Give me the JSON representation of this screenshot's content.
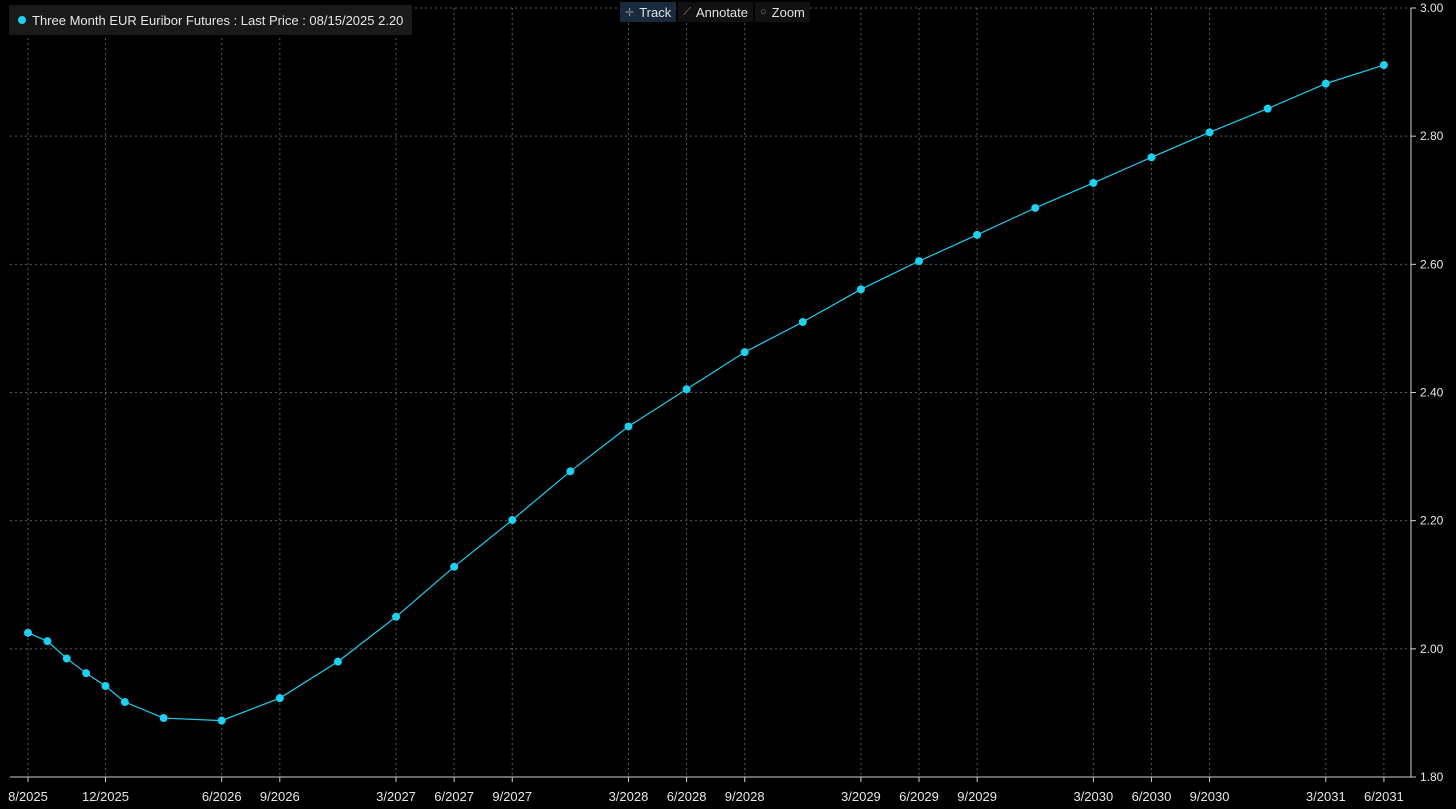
{
  "legend": {
    "label": "Three Month EUR Euribor Futures : Last Price : 08/15/2025 2.20"
  },
  "toolbar": {
    "track_label": "Track",
    "annotate_label": "Annotate",
    "zoom_label": "Zoom"
  },
  "colors": {
    "series": "#1fd0f0",
    "background": "#000000",
    "grid": "#5a5a5a"
  },
  "chart_data": {
    "type": "line",
    "title": "",
    "xlabel": "",
    "ylabel": "",
    "ylim": [
      1.8,
      3.0
    ],
    "yticks": [
      1.8,
      2.0,
      2.2,
      2.4,
      2.6,
      2.8,
      3.0
    ],
    "ytick_labels": [
      "1.80",
      "2.00",
      "2.20",
      "2.40",
      "2.60",
      "2.80",
      "3.00"
    ],
    "y_axis_side": "right",
    "grid": true,
    "legend_position": "top-left",
    "xticks": [
      "8/2025",
      "12/2025",
      "6/2026",
      "9/2026",
      "3/2027",
      "6/2027",
      "9/2027",
      "3/2028",
      "6/2028",
      "9/2028",
      "3/2029",
      "6/2029",
      "9/2029",
      "3/2030",
      "6/2030",
      "9/2030",
      "3/2031",
      "6/2031"
    ],
    "series": [
      {
        "name": "Three Month EUR Euribor Futures",
        "x": [
          "8/2025",
          "9/2025",
          "10/2025",
          "11/2025",
          "12/2025",
          "1/2026",
          "3/2026",
          "6/2026",
          "9/2026",
          "12/2026",
          "3/2027",
          "6/2027",
          "9/2027",
          "12/2027",
          "3/2028",
          "6/2028",
          "9/2028",
          "12/2028",
          "3/2029",
          "6/2029",
          "9/2029",
          "12/2029",
          "3/2030",
          "6/2030",
          "9/2030",
          "12/2030",
          "3/2031",
          "6/2031"
        ],
        "values": [
          2.025,
          2.012,
          1.985,
          1.962,
          1.942,
          1.917,
          1.892,
          1.888,
          1.923,
          1.98,
          2.05,
          2.128,
          2.201,
          2.277,
          2.347,
          2.405,
          2.463,
          2.51,
          2.561,
          2.605,
          2.646,
          2.688,
          2.727,
          2.767,
          2.806,
          2.843,
          2.882,
          2.911
        ]
      }
    ]
  }
}
